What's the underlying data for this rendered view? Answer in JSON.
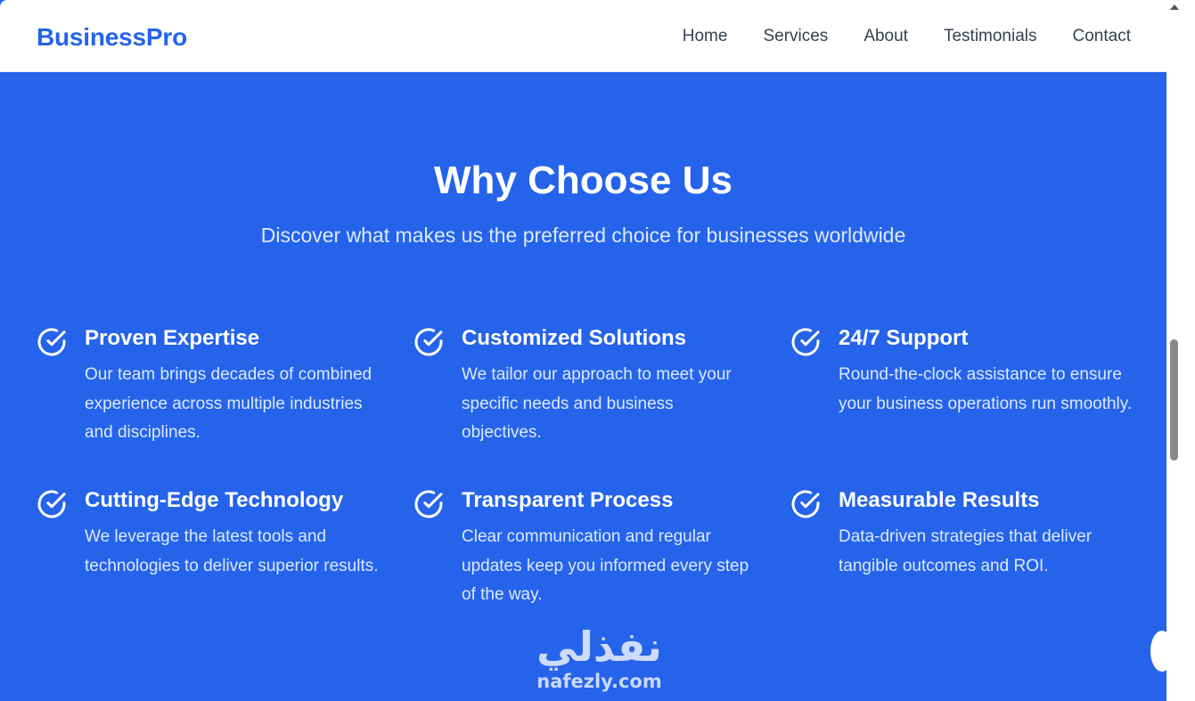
{
  "colors": {
    "brand_blue": "#2563eb",
    "text_light": "#dbeafe",
    "nav_text": "#374151",
    "white": "#ffffff"
  },
  "navbar": {
    "brand": "BusinessPro",
    "links": [
      "Home",
      "Services",
      "About",
      "Testimonials",
      "Contact"
    ]
  },
  "hero": {
    "title": "Why Choose Us",
    "subtitle": "Discover what makes us the preferred choice for businesses worldwide"
  },
  "features": [
    {
      "icon": "check-circle-icon",
      "title": "Proven Expertise",
      "description": "Our team brings decades of combined experience across multiple industries and disciplines."
    },
    {
      "icon": "check-circle-icon",
      "title": "Customized Solutions",
      "description": "We tailor our approach to meet your specific needs and business objectives."
    },
    {
      "icon": "check-circle-icon",
      "title": "24/7 Support",
      "description": "Round-the-clock assistance to ensure your business operations run smoothly."
    },
    {
      "icon": "check-circle-icon",
      "title": "Cutting-Edge Technology",
      "description": "We leverage the latest tools and technologies to deliver superior results."
    },
    {
      "icon": "check-circle-icon",
      "title": "Transparent Process",
      "description": "Clear communication and regular updates keep you informed every step of the way."
    },
    {
      "icon": "check-circle-icon",
      "title": "Measurable Results",
      "description": "Data-driven strategies that deliver tangible outcomes and ROI."
    }
  ],
  "watermark": {
    "arabic": "نفذلي",
    "latin": "nafezly.com"
  }
}
